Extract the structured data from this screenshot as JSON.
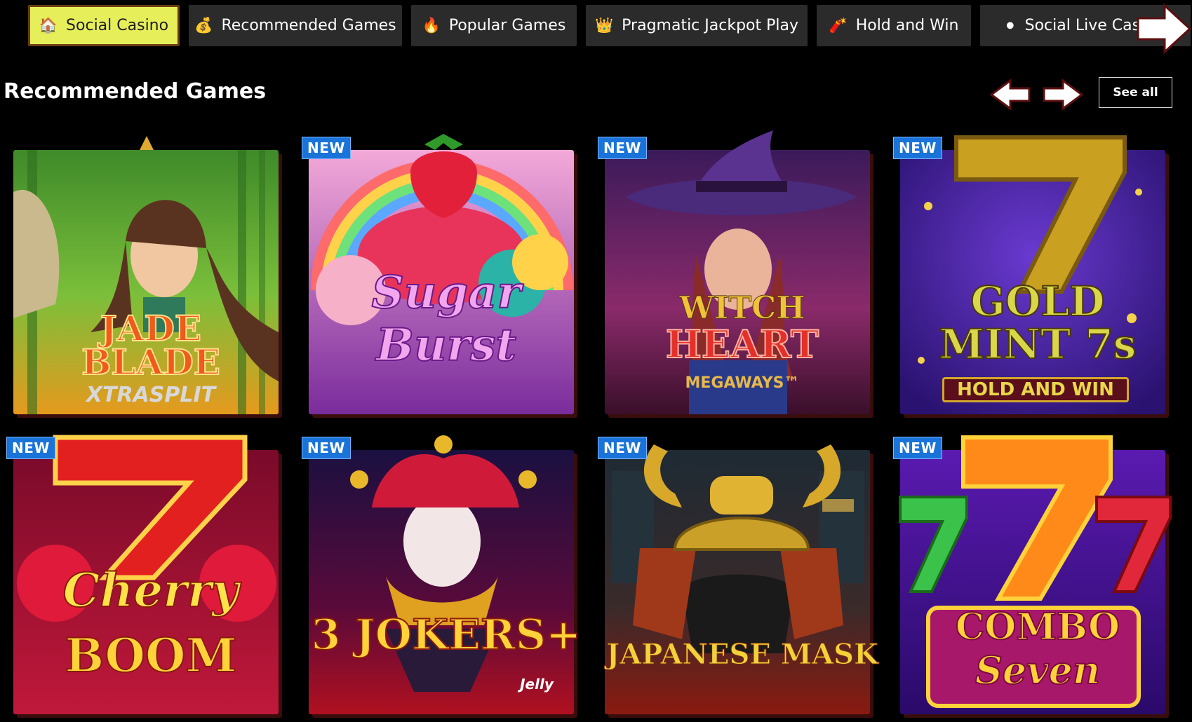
{
  "tabs": [
    {
      "label": "Social Casino",
      "icon": "house-icon",
      "active": true
    },
    {
      "label": "Recommended Games",
      "icon": "money-bag-icon",
      "active": false
    },
    {
      "label": "Popular Games",
      "icon": "fire-icon",
      "active": false
    },
    {
      "label": "Pragmatic Jackpot Play",
      "icon": "crown-icon",
      "active": false
    },
    {
      "label": "Hold and Win",
      "icon": "dynamite-icon",
      "active": false
    },
    {
      "label": "Social Live Casino",
      "icon": "poker-chip-icon",
      "active": false
    }
  ],
  "section": {
    "title": "Recommended Games",
    "see_all_label": "See all"
  },
  "badge_label": "NEW",
  "games": [
    {
      "title_line1": "JADE",
      "title_line2": "BLADE",
      "subtitle": "XTRASPLIT",
      "is_new": false
    },
    {
      "title_line1": "Sugar",
      "title_line2": "Burst",
      "subtitle": "",
      "is_new": true
    },
    {
      "title_line1": "WITCH",
      "title_line2": "HEART",
      "subtitle": "MEGAWAYS™",
      "is_new": true
    },
    {
      "title_line1": "GOLD",
      "title_line2": "MINT 7s",
      "subtitle": "HOLD AND WIN",
      "is_new": true
    },
    {
      "title_line1": "Cherry",
      "title_line2": "BOOM",
      "subtitle": "",
      "is_new": true
    },
    {
      "title_line1": "3 JOKERS+",
      "title_line2": "",
      "subtitle": "Jelly",
      "is_new": true
    },
    {
      "title_line1": "JAPANESE MASK",
      "title_line2": "",
      "subtitle": "",
      "is_new": true
    },
    {
      "title_line1": "COMBO",
      "title_line2": "Seven",
      "subtitle": "",
      "is_new": true
    }
  ],
  "colors": {
    "background": "#000000",
    "tab_bg": "#2b2b2b",
    "tab_active_bg": "#e6ee5a",
    "badge_bg": "#1a73d9"
  }
}
